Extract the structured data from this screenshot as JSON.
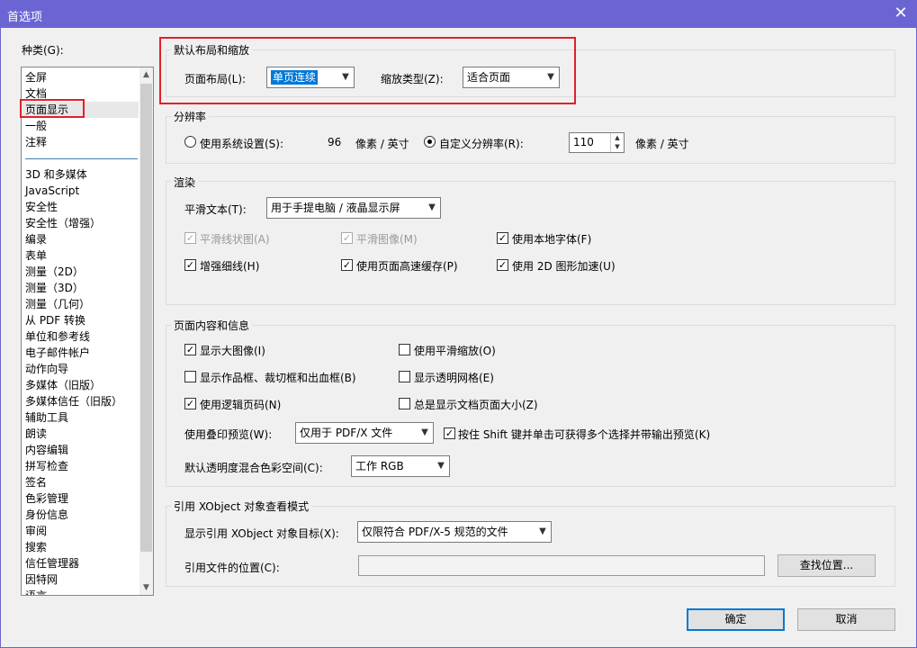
{
  "window": {
    "title": "首选项",
    "close_glyph": "✕"
  },
  "categories": {
    "label": "种类(G):",
    "top_items": [
      "全屏",
      "文档",
      "页面显示",
      "一般",
      "注释"
    ],
    "items": [
      "3D 和多媒体",
      "JavaScript",
      "安全性",
      "安全性（增强）",
      "编录",
      "表单",
      "测量（2D）",
      "测量（3D）",
      "测量（几何）",
      "从 PDF 转换",
      "单位和参考线",
      "电子邮件帐户",
      "动作向导",
      "多媒体（旧版）",
      "多媒体信任（旧版）",
      "辅助工具",
      "朗读",
      "内容编辑",
      "拼写检查",
      "签名",
      "色彩管理",
      "身份信息",
      "审阅",
      "搜索",
      "信任管理器",
      "因特网",
      "语言"
    ],
    "selected": "页面显示"
  },
  "layout_zoom": {
    "title": "默认布局和缩放",
    "page_layout_label": "页面布局(L):",
    "page_layout_value": "单页连续",
    "zoom_label": "缩放类型(Z):",
    "zoom_value": "适合页面"
  },
  "resolution": {
    "title": "分辨率",
    "system_label": "使用系统设置(S):",
    "system_value": "96",
    "unit1": "像素 / 英寸",
    "custom_label": "自定义分辨率(R):",
    "custom_value": "110",
    "unit2": "像素 / 英寸",
    "selected": "custom"
  },
  "rendering": {
    "title": "渲染",
    "smooth_text_label": "平滑文本(T):",
    "smooth_text_value": "用于手提电脑 / 液晶显示屏",
    "options": [
      {
        "label": "平滑线状图(A)",
        "checked": true,
        "disabled": true
      },
      {
        "label": "平滑图像(M)",
        "checked": true,
        "disabled": true
      },
      {
        "label": "使用本地字体(F)",
        "checked": true,
        "disabled": false
      },
      {
        "label": "增强细线(H)",
        "checked": true,
        "disabled": false
      },
      {
        "label": "使用页面高速缓存(P)",
        "checked": true,
        "disabled": false
      },
      {
        "label": "使用 2D 图形加速(U)",
        "checked": true,
        "disabled": false
      }
    ]
  },
  "page_content": {
    "title": "页面内容和信息",
    "options": [
      {
        "label": "显示大图像(I)",
        "checked": true
      },
      {
        "label": "使用平滑缩放(O)",
        "checked": false
      },
      {
        "label": "显示作品框、裁切框和出血框(B)",
        "checked": false
      },
      {
        "label": "显示透明网格(E)",
        "checked": false
      },
      {
        "label": "使用逻辑页码(N)",
        "checked": true
      },
      {
        "label": "总是显示文档页面大小(Z)",
        "checked": false
      }
    ],
    "overprint_label": "使用叠印预览(W):",
    "overprint_value": "仅用于 PDF/X 文件",
    "shift_label": "按住 Shift 键并单击可获得多个选择并带输出预览(K)",
    "shift_checked": true,
    "blend_label": "默认透明度混合色彩空间(C):",
    "blend_value": "工作 RGB"
  },
  "xobject": {
    "title": "引用 XObject 对象查看模式",
    "target_label": "显示引用 XObject 对象目标(X):",
    "target_value": "仅限符合 PDF/X-5 规范的文件",
    "location_label": "引用文件的位置(C):",
    "location_value": "",
    "browse_label": "查找位置..."
  },
  "buttons": {
    "ok": "确定",
    "cancel": "取消"
  },
  "check_glyph": "✓",
  "colors": {
    "titlebar": "#6b64d3",
    "highlight": "#e0202a",
    "accent": "#0078d7"
  }
}
